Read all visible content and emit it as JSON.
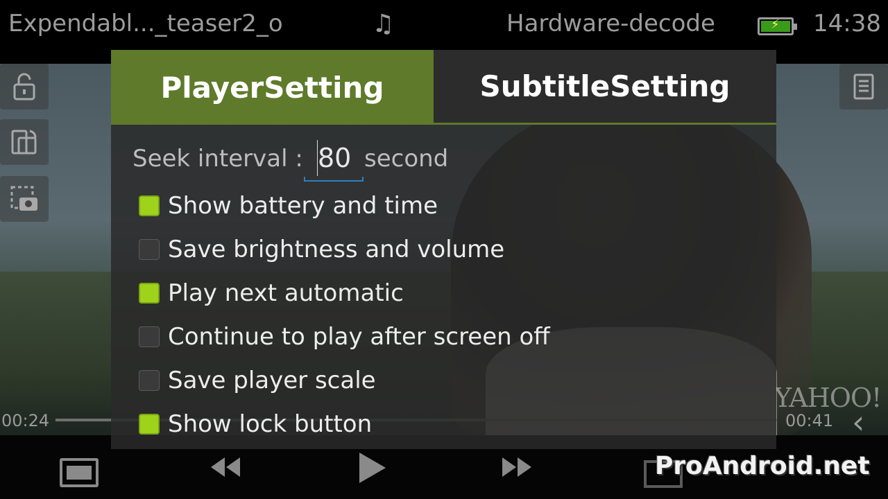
{
  "status_bar": {
    "title": "Expendabl..._teaser2_o",
    "music_icon": "♫",
    "decode_mode": "Hardware-decode",
    "battery_icon": "battery-charging",
    "time": "14:38"
  },
  "player": {
    "elapsed": "00:24",
    "remaining": "00:41",
    "video_watermark": "YAHOO!",
    "progress": 0.04
  },
  "side_buttons": {
    "left": [
      "lock-icon",
      "rotate-icon",
      "screenshot-icon"
    ],
    "right": [
      "playlist-icon"
    ]
  },
  "settings": {
    "tabs": [
      {
        "label": "PlayerSetting",
        "active": true
      },
      {
        "label": "SubtitleSetting",
        "active": false
      }
    ],
    "seek_interval": {
      "label": "Seek interval  :",
      "value": "80",
      "unit": "second"
    },
    "options": [
      {
        "label": "Show battery and time",
        "checked": true
      },
      {
        "label": "Save brightness and volume",
        "checked": false
      },
      {
        "label": "Play next automatic",
        "checked": true
      },
      {
        "label": "Continue to play after screen off",
        "checked": false
      },
      {
        "label": "Save player scale",
        "checked": false
      },
      {
        "label": "Show lock button",
        "checked": true
      }
    ]
  },
  "watermark": "ProAndroid.net",
  "colors": {
    "accent_green": "#5e7a2a",
    "checkbox_on": "#9fd21a",
    "input_underline": "#2f7fbf"
  }
}
